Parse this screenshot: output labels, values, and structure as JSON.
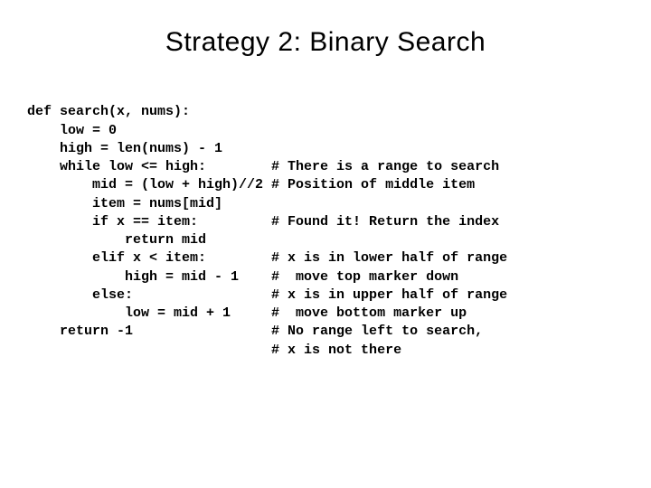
{
  "title": "Strategy 2: Binary Search",
  "code": {
    "l01": "def search(x, nums):",
    "l02": "    low = 0",
    "l03": "    high = len(nums) - 1",
    "l04": "    while low <= high:        # There is a range to search",
    "l05": "        mid = (low + high)//2 # Position of middle item",
    "l06": "        item = nums[mid]",
    "l07": "        if x == item:         # Found it! Return the index",
    "l08": "            return mid",
    "l09": "        elif x < item:        # x is in lower half of range",
    "l10": "            high = mid - 1    #  move top marker down",
    "l11": "        else:                 # x is in upper half of range",
    "l12": "            low = mid + 1     #  move bottom marker up",
    "l13": "    return -1                 # No range left to search,",
    "l14": "                              # x is not there"
  }
}
